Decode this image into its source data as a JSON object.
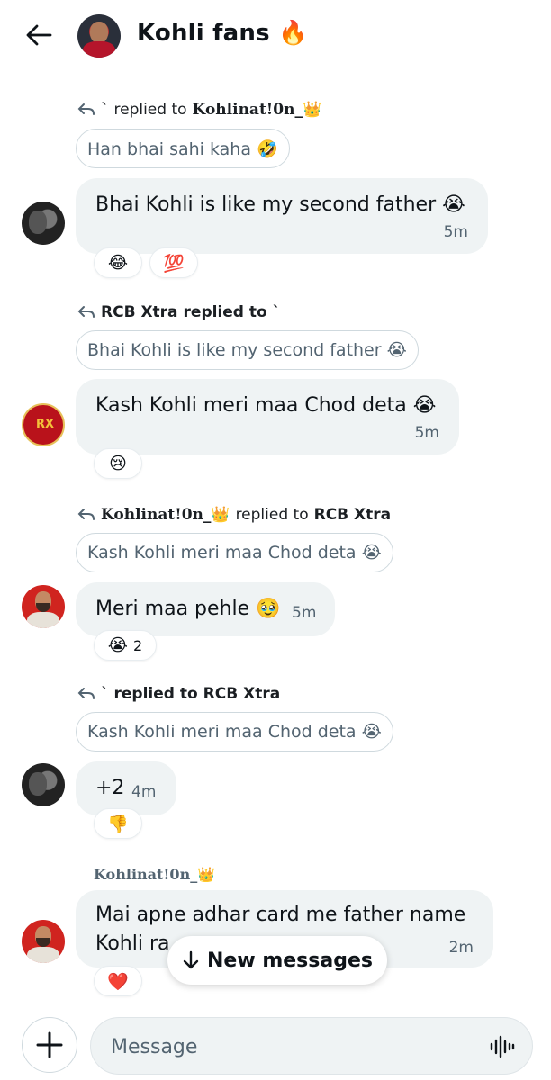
{
  "header": {
    "title": "Kohli fans 🔥",
    "back_icon": "arrow-left-icon",
    "avatar": "group-avatar"
  },
  "messages": [
    {
      "reply_author": "`",
      "reply_verb": "replied to",
      "reply_target": "Kohlinat!0n_👑",
      "quote": "Han bhai sahi kaha 🤣",
      "text": "Bhai Kohli is like my second father 😭",
      "time": "5m",
      "reactions": [
        {
          "emoji": "😂",
          "count": ""
        },
        {
          "emoji": "💯",
          "count": ""
        }
      ]
    },
    {
      "reply_author": "RCB Xtra",
      "reply_verb": "replied to",
      "reply_target": "`",
      "quote": "Bhai Kohli is like my second father 😭",
      "text": "Kash Kohli meri maa Chod deta 😭",
      "time": "5m",
      "reactions": [
        {
          "emoji": "😢",
          "count": ""
        }
      ]
    },
    {
      "reply_author": "Kohlinat!0n_👑",
      "reply_verb": "replied to",
      "reply_target": "RCB Xtra",
      "quote": "Kash Kohli meri maa Chod deta 😭",
      "text": "Meri maa pehle 🥹",
      "time": "5m",
      "reactions": [
        {
          "emoji": "😭",
          "count": "2"
        }
      ]
    },
    {
      "reply_author": "`",
      "reply_verb": "replied to",
      "reply_target": "RCB Xtra",
      "quote": "Kash Kohli meri maa Chod deta 😭",
      "text": "+2",
      "time": "4m",
      "reactions": [
        {
          "emoji": "👎",
          "count": ""
        }
      ]
    },
    {
      "sender": "Kohlinat!0n_👑",
      "text_line1": "Mai apne adhar card me father name",
      "text_line2": "Kohli ra",
      "time": "2m",
      "reactions": [
        {
          "emoji": "❤️",
          "count": ""
        }
      ]
    }
  ],
  "new_messages": {
    "label": "New messages",
    "icon": "arrow-down-icon"
  },
  "composer": {
    "placeholder": "Message",
    "plus_icon": "plus-icon",
    "voice_icon": "waveform-icon"
  }
}
